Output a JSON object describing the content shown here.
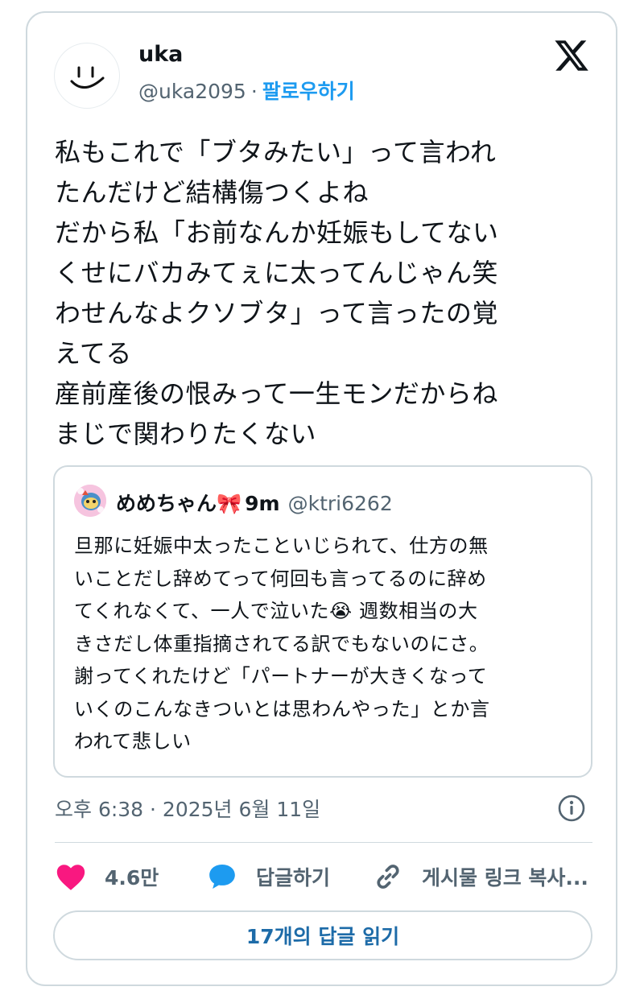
{
  "author": {
    "name": "uka",
    "handle": "@uka2095",
    "separator": "·",
    "follow_label": "팔로우하기",
    "avatar_icon": "smiley-face-avatar"
  },
  "brand_icon": "x-logo-icon",
  "tweet_text": "私もこれで「ブタみたい」って言われ\nたんだけど結構傷つくよね\nだから私「お前なんか妊娠もしてない\nくせにバカみてぇに太ってんじゃん笑\nわせんなよクソブタ」って言ったの覚\nえてる\n産前産後の恨みって一生モンだからね\nまじで関わりたくない",
  "quoted": {
    "name": "めめちゃん🎀",
    "time": "9m",
    "handle": "@ktri6262",
    "text": "旦那に妊娠中太ったこといじられて、仕方の無\nいことだし辞めてって何回も言ってるのに辞め\nてくれなくて、一人で泣いた😭 週数相当の大\nきさだし体重指摘されてる訳でもないのにさ。\n謝ってくれたけど「パートナーが大きくなって\nいくのこんなきついとは思わんやった」とか言\nわれて悲しい"
  },
  "timestamp": "오후 6:38 · 2025년 6월 11일",
  "actions": {
    "like_count": "4.6만",
    "reply_label": "답글하기",
    "copy_link_label": "게시물 링크 복사..."
  },
  "read_replies_label": "17개의 답글 읽기",
  "colors": {
    "accent": "#1d9bf0",
    "like": "#f91880",
    "muted": "#536471",
    "border": "#cfd9de",
    "text": "#0f1419"
  }
}
